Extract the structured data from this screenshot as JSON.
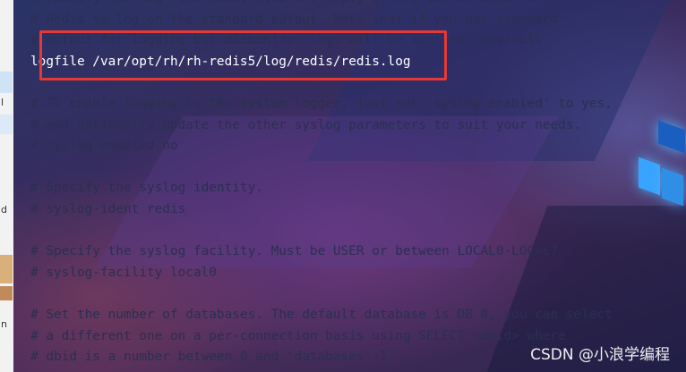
{
  "terminal": {
    "lines": [
      {
        "text": "# specify the log file name. Also the empty string can be used to force",
        "kind": "comment"
      },
      {
        "text": "# Redis to log on the standard output. Note that if you use standard",
        "kind": "comment"
      },
      {
        "text": "# output for logging but daemonize, logs will be sent to /dev/null",
        "kind": "comment"
      },
      {
        "text": "logfile /var/opt/rh/rh-redis5/log/redis/redis.log",
        "kind": "command"
      },
      {
        "text": "",
        "kind": "blank"
      },
      {
        "text": "# To enable logging to the system logger, just set 'syslog-enabled' to yes,",
        "kind": "comment"
      },
      {
        "text": "# and optionally update the other syslog parameters to suit your needs.",
        "kind": "comment"
      },
      {
        "text": "# syslog-enabled no",
        "kind": "comment"
      },
      {
        "text": "",
        "kind": "blank"
      },
      {
        "text": "# Specify the syslog identity.",
        "kind": "comment"
      },
      {
        "text": "# syslog-ident redis",
        "kind": "comment"
      },
      {
        "text": "",
        "kind": "blank"
      },
      {
        "text": "# Specify the syslog facility. Must be USER or between LOCAL0-LOCAL7.",
        "kind": "comment"
      },
      {
        "text": "# syslog-facility local0",
        "kind": "comment"
      },
      {
        "text": "",
        "kind": "blank"
      },
      {
        "text": "# Set the number of databases. The default database is DB 0, you can select",
        "kind": "comment"
      },
      {
        "text": "# a different one on a per-connection basis using SELECT <dbid> where",
        "kind": "comment"
      },
      {
        "text": "# dbid is a number between 0 and 'databases'-1",
        "kind": "comment"
      }
    ],
    "comment_color": "#2b2f52",
    "command_color": "#ffffff",
    "highlight_color": "#e53935"
  },
  "left_strip": {
    "glyphs": [
      "l",
      "d",
      "n"
    ]
  },
  "watermark": "CSDN @小浪学编程"
}
